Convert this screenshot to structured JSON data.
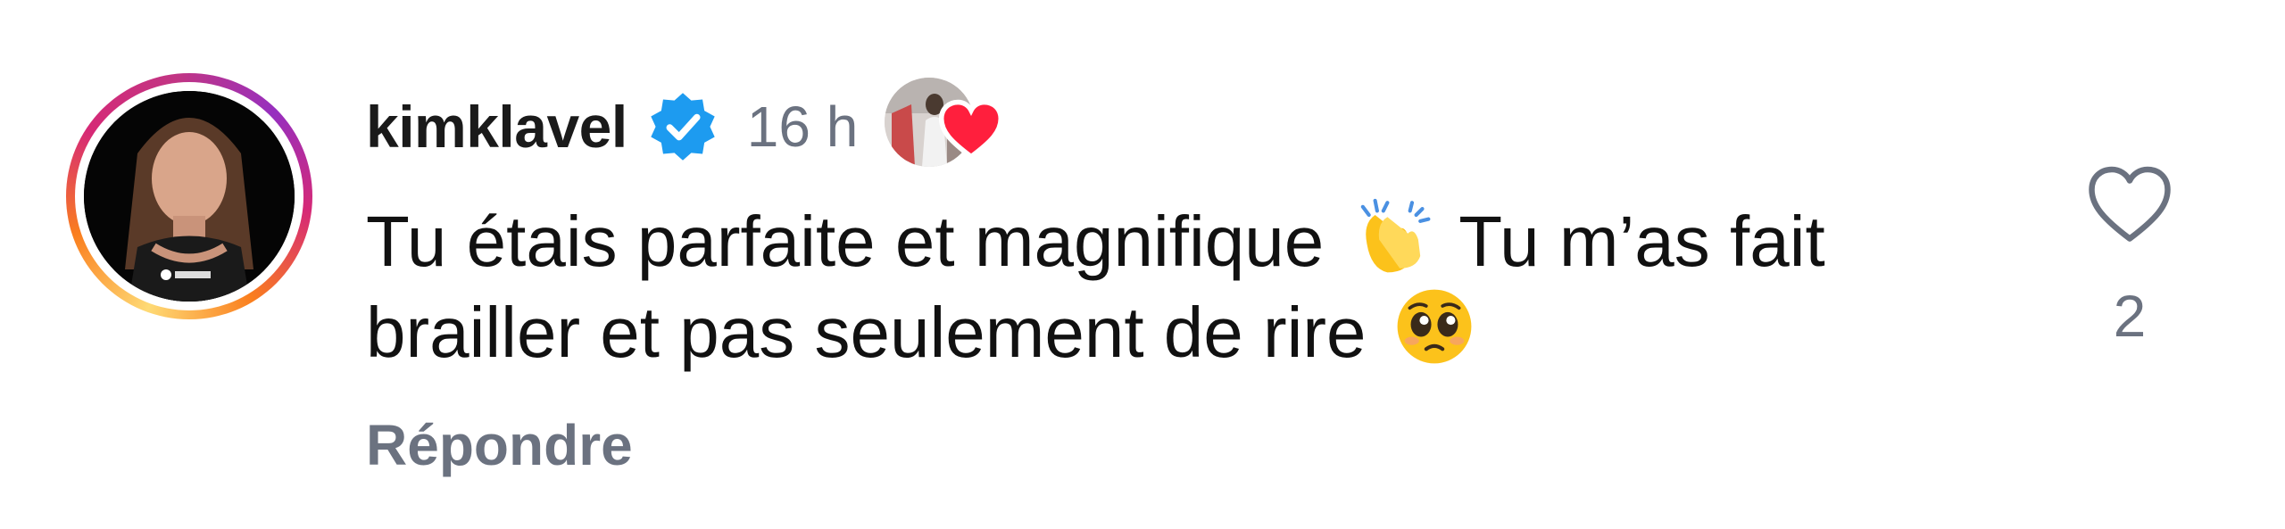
{
  "comment": {
    "username": "kimklavel",
    "verified": true,
    "time": "16 h",
    "creator_liked": true,
    "text_part1": "Tu étais parfaite et magnifique",
    "emoji1": "clapping-hands",
    "text_part2": "Tu m’as fait brailler et pas seulement de rire",
    "emoji2": "pleading-face",
    "reply_label": "Répondre",
    "like_count": "2"
  },
  "colors": {
    "verified_blue": "#1d9bf0",
    "heart_red": "#ff1f3d",
    "muted_gray": "#6b7280",
    "text": "#111111"
  },
  "icons": {
    "like": "heart-outline-icon",
    "verified": "verified-badge-icon",
    "creator_heart": "heart-filled-icon"
  }
}
